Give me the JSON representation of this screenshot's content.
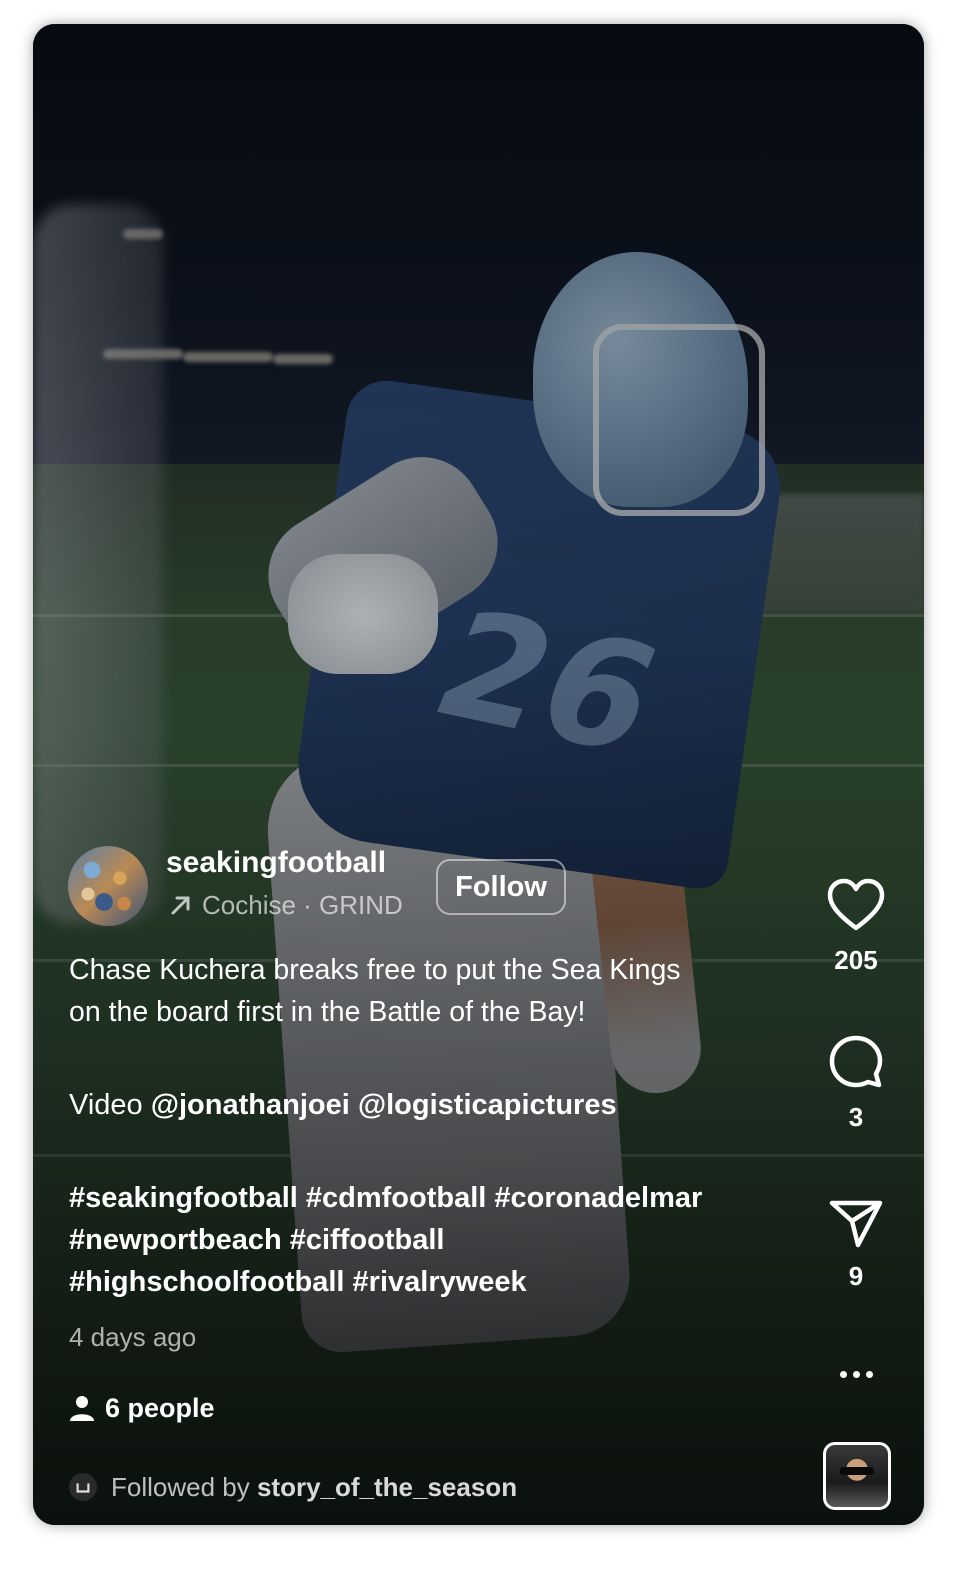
{
  "post": {
    "username": "seakingfootball",
    "audio_label": "Cochise · GRIND",
    "follow_label": "Follow",
    "caption_line1": "Chase Kuchera breaks free to put the Sea Kings",
    "caption_line2": "on the board first in the Battle of the Bay!",
    "video_prefix": "Video ",
    "mentions": "@jonathanjoei @logisticapictures",
    "hashtags_line1": "#seakingfootball #cdmfootball #coronadelmar",
    "hashtags_line2": "#newportbeach #ciffootball",
    "hashtags_line3": "#highschoolfootball #rivalryweek",
    "timestamp": "4 days ago",
    "people_tag": "6 people",
    "followed_by_prefix": "Followed by ",
    "followed_by_name": "story_of_the_season"
  },
  "actions": {
    "likes": "205",
    "comments": "3",
    "shares": "9"
  },
  "background": {
    "jersey_text": "26"
  },
  "icons": {
    "audio": "arrow-up-right-icon",
    "like": "heart-icon",
    "comment": "comment-bubble-icon",
    "share": "paper-plane-icon",
    "more": "more-dots-icon",
    "people": "person-icon",
    "followed": "avatar-mini-icon"
  },
  "colors": {
    "text": "#ffffff",
    "muted_text": "#ebebeb"
  }
}
